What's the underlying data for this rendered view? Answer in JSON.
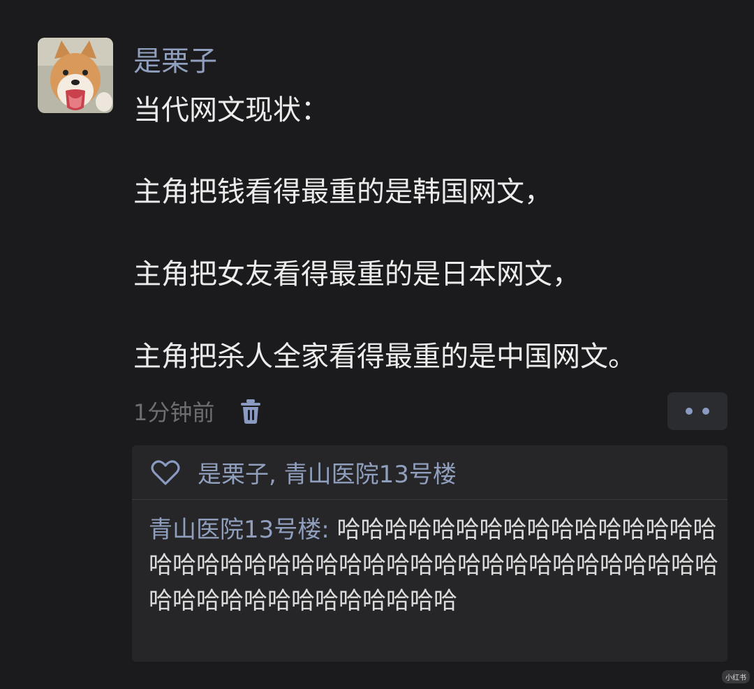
{
  "post": {
    "author": "是栗子",
    "lines": [
      "当代网文现状：",
      "主角把钱看得最重的是韩国网文，",
      "主角把女友看得最重的是日本网文，",
      "主角把杀人全家看得最重的是中国网文。"
    ],
    "time": "1分钟前",
    "avatar_icon": "shiba-dog-avatar"
  },
  "actions": {
    "delete_icon": "trash-icon",
    "more_icon": "more-dots-icon"
  },
  "likes": {
    "icon": "heart-icon",
    "names": "是栗子, 青山医院13号楼"
  },
  "comments": [
    {
      "name": "青山医院13号楼",
      "separator": ": ",
      "text": "哈哈哈哈哈哈哈哈哈哈哈哈哈哈哈哈哈哈哈哈哈哈哈哈哈哈哈哈哈哈哈哈哈哈哈哈哈哈哈哈哈哈哈哈哈哈哈哈哈哈哈哈哈"
    }
  ],
  "watermark": "小红书",
  "colors": {
    "background": "#1b1b1d",
    "name_blue": "#8f9fbd",
    "panel": "#262628"
  }
}
